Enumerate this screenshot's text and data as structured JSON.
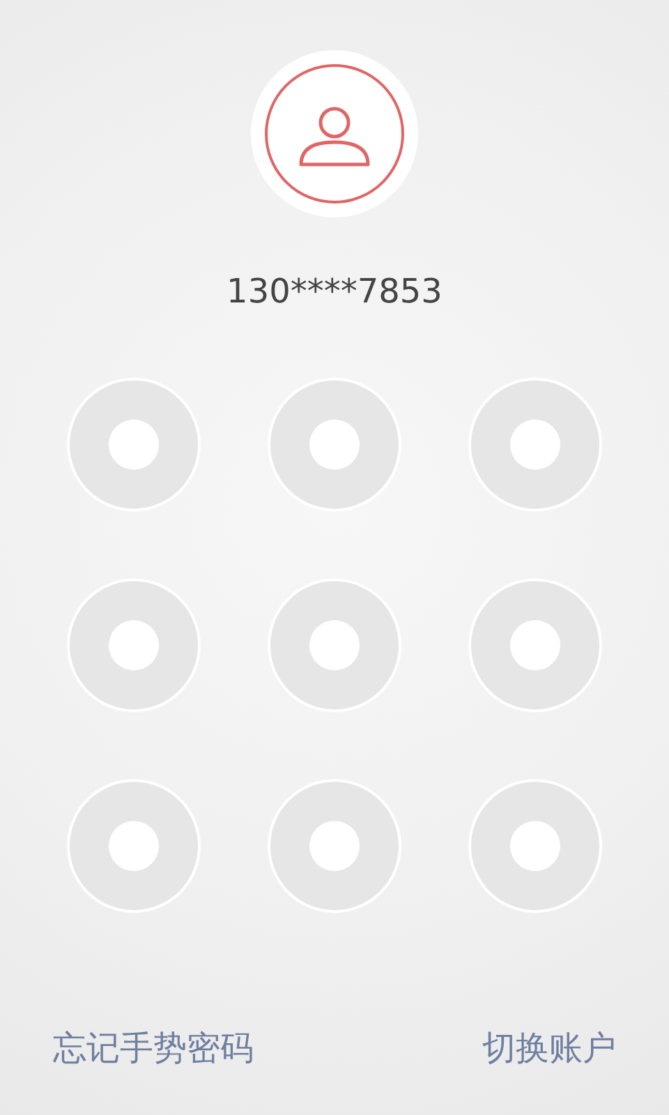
{
  "account": {
    "phone": "130****7853"
  },
  "pattern_dots": [
    {
      "selected": false
    },
    {
      "selected": false
    },
    {
      "selected": false
    },
    {
      "selected": false
    },
    {
      "selected": false
    },
    {
      "selected": false
    },
    {
      "selected": false
    },
    {
      "selected": false
    },
    {
      "selected": false
    }
  ],
  "links": [
    {
      "label": "忘记手势密码"
    },
    {
      "label": "切换账户"
    }
  ]
}
